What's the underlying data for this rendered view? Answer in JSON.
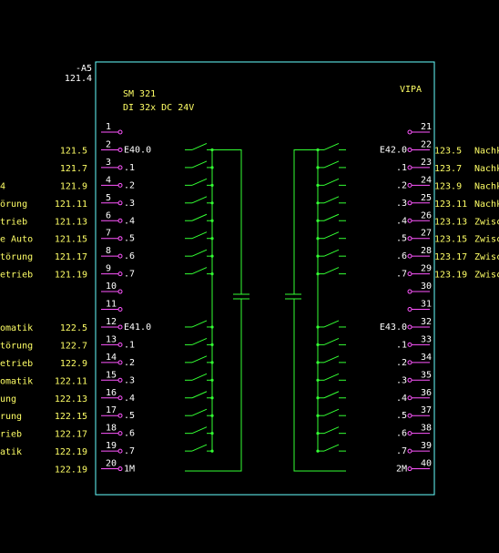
{
  "module": {
    "designation": "-A5",
    "page_ref": "121.4",
    "type": "SM 321",
    "spec": "DI 32x DC 24V",
    "vendor": "VIPA"
  },
  "left_terminals": [
    {
      "pin": "1",
      "addr": "",
      "ref": "",
      "desc": ""
    },
    {
      "pin": "2",
      "addr": "E40.0",
      "ref": "121.5",
      "desc": ""
    },
    {
      "pin": "3",
      "addr": ".1",
      "ref": "121.7",
      "desc": ""
    },
    {
      "pin": "4",
      "addr": ".2",
      "ref": "121.9",
      "desc": "4"
    },
    {
      "pin": "5",
      "addr": ".3",
      "ref": "121.11",
      "desc": "örung"
    },
    {
      "pin": "6",
      "addr": ".4",
      "ref": "121.13",
      "desc": "trieb"
    },
    {
      "pin": "7",
      "addr": ".5",
      "ref": "121.15",
      "desc": "e Auto"
    },
    {
      "pin": "8",
      "addr": ".6",
      "ref": "121.17",
      "desc": "törung"
    },
    {
      "pin": "9",
      "addr": ".7",
      "ref": "121.19",
      "desc": "etrieb"
    },
    {
      "pin": "10",
      "addr": "",
      "ref": "",
      "desc": ""
    },
    {
      "pin": "11",
      "addr": "",
      "ref": "",
      "desc": ""
    },
    {
      "pin": "12",
      "addr": "E41.0",
      "ref": "122.5",
      "desc": "omatik"
    },
    {
      "pin": "13",
      "addr": ".1",
      "ref": "122.7",
      "desc": "törung"
    },
    {
      "pin": "14",
      "addr": ".2",
      "ref": "122.9",
      "desc": "etrieb"
    },
    {
      "pin": "15",
      "addr": ".3",
      "ref": "122.11",
      "desc": "omatik"
    },
    {
      "pin": "16",
      "addr": ".4",
      "ref": "122.13",
      "desc": "ung"
    },
    {
      "pin": "17",
      "addr": ".5",
      "ref": "122.15",
      "desc": "rung"
    },
    {
      "pin": "18",
      "addr": ".6",
      "ref": "122.17",
      "desc": "rieb"
    },
    {
      "pin": "19",
      "addr": ".7",
      "ref": "122.19",
      "desc": "atik"
    },
    {
      "pin": "20",
      "addr": "1M",
      "ref": "122.19",
      "desc": ""
    }
  ],
  "right_terminals": [
    {
      "pin": "21",
      "addr": "",
      "ref": "",
      "desc": ""
    },
    {
      "pin": "22",
      "addr": "E42.0",
      "ref": "123.5",
      "desc": "Nachk"
    },
    {
      "pin": "23",
      "addr": ".1",
      "ref": "123.7",
      "desc": "Nachk"
    },
    {
      "pin": "24",
      "addr": ".2",
      "ref": "123.9",
      "desc": "Nachk"
    },
    {
      "pin": "25",
      "addr": ".3",
      "ref": "123.11",
      "desc": "Nachk"
    },
    {
      "pin": "26",
      "addr": ".4",
      "ref": "123.13",
      "desc": "Zwisc"
    },
    {
      "pin": "27",
      "addr": ".5",
      "ref": "123.15",
      "desc": "Zwisc"
    },
    {
      "pin": "28",
      "addr": ".6",
      "ref": "123.17",
      "desc": "Zwisc"
    },
    {
      "pin": "29",
      "addr": ".7",
      "ref": "123.19",
      "desc": "Zwisc"
    },
    {
      "pin": "30",
      "addr": "",
      "ref": "",
      "desc": ""
    },
    {
      "pin": "31",
      "addr": "",
      "ref": "",
      "desc": ""
    },
    {
      "pin": "32",
      "addr": "E43.0",
      "ref": "",
      "desc": ""
    },
    {
      "pin": "33",
      "addr": ".1",
      "ref": "",
      "desc": ""
    },
    {
      "pin": "34",
      "addr": ".2",
      "ref": "",
      "desc": ""
    },
    {
      "pin": "35",
      "addr": ".3",
      "ref": "",
      "desc": ""
    },
    {
      "pin": "36",
      "addr": ".4",
      "ref": "",
      "desc": ""
    },
    {
      "pin": "37",
      "addr": ".5",
      "ref": "",
      "desc": ""
    },
    {
      "pin": "38",
      "addr": ".6",
      "ref": "",
      "desc": ""
    },
    {
      "pin": "39",
      "addr": ".7",
      "ref": "",
      "desc": ""
    },
    {
      "pin": "40",
      "addr": "2M",
      "ref": "",
      "desc": ""
    }
  ],
  "colors": {
    "background": "#000000",
    "module_border": "#66ffff",
    "wiring": "#33ff33",
    "terminal": "#ff55ff",
    "label": "#ffff66",
    "title": "#ffffff"
  }
}
